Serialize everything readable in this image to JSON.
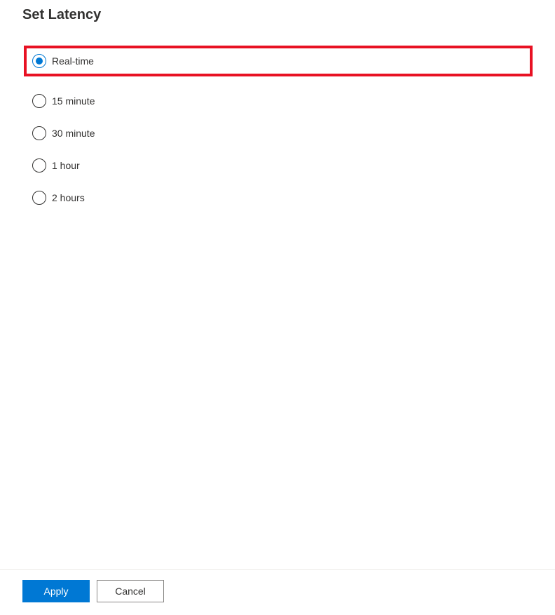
{
  "title": "Set Latency",
  "options": [
    {
      "label": "Real-time",
      "selected": true,
      "highlighted": true
    },
    {
      "label": "15 minute",
      "selected": false,
      "highlighted": false
    },
    {
      "label": "30 minute",
      "selected": false,
      "highlighted": false
    },
    {
      "label": "1 hour",
      "selected": false,
      "highlighted": false
    },
    {
      "label": "2 hours",
      "selected": false,
      "highlighted": false
    }
  ],
  "footer": {
    "apply_label": "Apply",
    "cancel_label": "Cancel"
  },
  "colors": {
    "accent": "#0078d4",
    "highlight_border": "#e81123"
  }
}
